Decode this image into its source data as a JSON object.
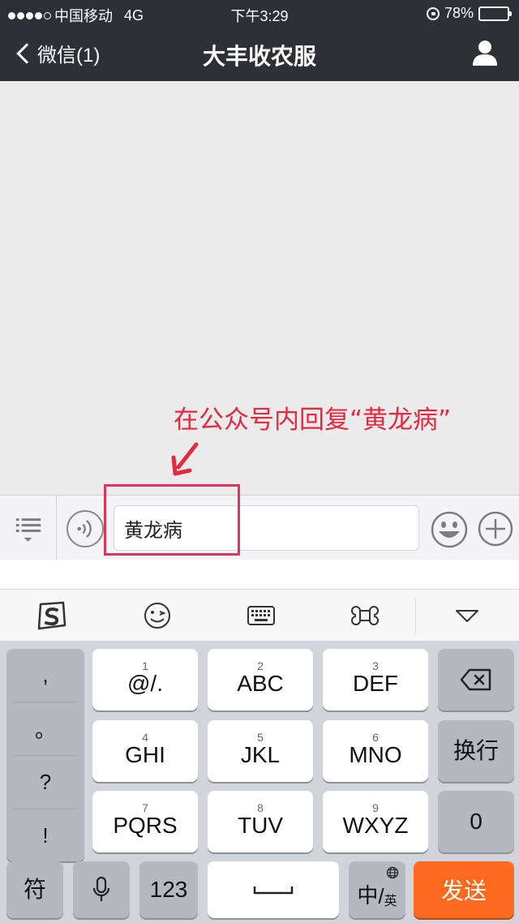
{
  "status_bar": {
    "carrier": "中国移动",
    "network": "4G",
    "time": "下午3:29",
    "battery": "78%",
    "battery_level": 0.78
  },
  "nav": {
    "back_label": "微信(1)",
    "title": "大丰收农服"
  },
  "annotation": {
    "text": "在公众号内回复“黄龙病”"
  },
  "input": {
    "value": "黄龙病"
  },
  "keyboard": {
    "punctuation": [
      ",",
      "。",
      "?",
      "!"
    ],
    "keys": [
      {
        "num": "1",
        "label": "@/."
      },
      {
        "num": "2",
        "label": "ABC"
      },
      {
        "num": "3",
        "label": "DEF"
      },
      {
        "num": "4",
        "label": "GHI"
      },
      {
        "num": "5",
        "label": "JKL"
      },
      {
        "num": "6",
        "label": "MNO"
      },
      {
        "num": "7",
        "label": "PQRS"
      },
      {
        "num": "8",
        "label": "TUV"
      },
      {
        "num": "9",
        "label": "WXYZ"
      }
    ],
    "newline_label": "换行",
    "zero_label": "0",
    "symbol_label": "符",
    "num_label": "123",
    "lang_main": "中",
    "lang_sub": "英",
    "send_label": "发送"
  }
}
